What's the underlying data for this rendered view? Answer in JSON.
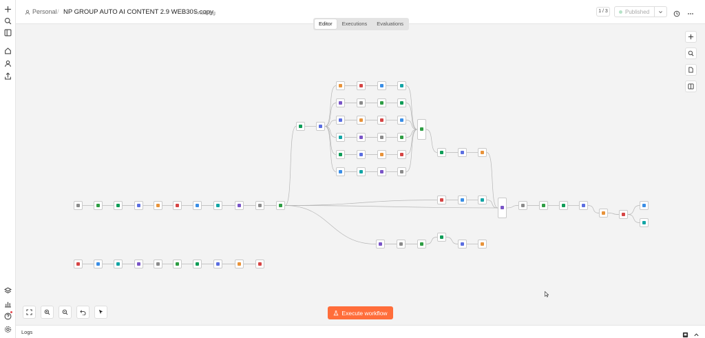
{
  "header": {
    "owner": "Personal",
    "separator": "/",
    "title": "NP GROUP AUTO AI CONTENT 2.9 WEB30S copy",
    "add_tag": "+ Add tag",
    "pager": "1 / 3",
    "publish_label": "Published",
    "publish_dot_color": "#b6e3c8"
  },
  "tabs": [
    {
      "label": "Editor",
      "active": true
    },
    {
      "label": "Executions",
      "active": false
    },
    {
      "label": "Evaluations",
      "active": false
    }
  ],
  "sidebar": {
    "icons": [
      "plus-icon",
      "search-icon",
      "panel-icon",
      "home-icon",
      "user-icon",
      "share-icon",
      "template-icon",
      "insights-icon",
      "help-icon",
      "settings-icon"
    ]
  },
  "canvas": {
    "node_accent_colors": [
      "#8b8b8b",
      "#2f9e44",
      "#0f9d58",
      "#5b6ee1",
      "#e8933a",
      "#d64545",
      "#3a8ee6",
      "#12a5a5",
      "#7a55c7"
    ]
  },
  "execute_button": {
    "label": "Execute workflow",
    "color": "#ff6d3a"
  },
  "logs": {
    "label": "Logs"
  }
}
